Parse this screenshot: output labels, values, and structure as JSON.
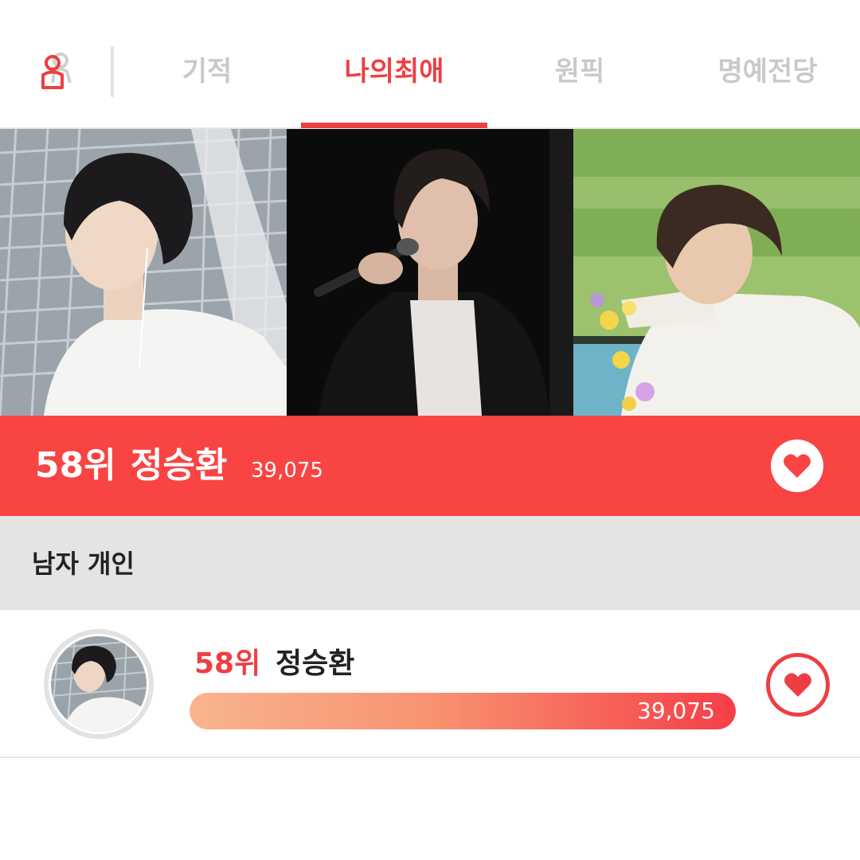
{
  "colors": {
    "accent": "#ee3e42",
    "banner": "#f94444",
    "tab_inactive": "#c9c9c9",
    "category_bg": "#e4e4e4"
  },
  "topbar": {
    "profile_icon": "user-profile-icon",
    "tabs": [
      {
        "label": "기적",
        "active": false
      },
      {
        "label": "나의최애",
        "active": true
      },
      {
        "label": "원픽",
        "active": false
      },
      {
        "label": "명예전당",
        "active": false
      }
    ]
  },
  "banner": {
    "rank": "58위",
    "name": "정승환",
    "score": "39,075",
    "heart_icon": "heart-icon"
  },
  "category": {
    "label": "남자 개인"
  },
  "ranking": [
    {
      "rank": "58위",
      "name": "정승환",
      "score": "39,075",
      "progress": 1.0,
      "heart_icon": "heart-icon"
    }
  ]
}
